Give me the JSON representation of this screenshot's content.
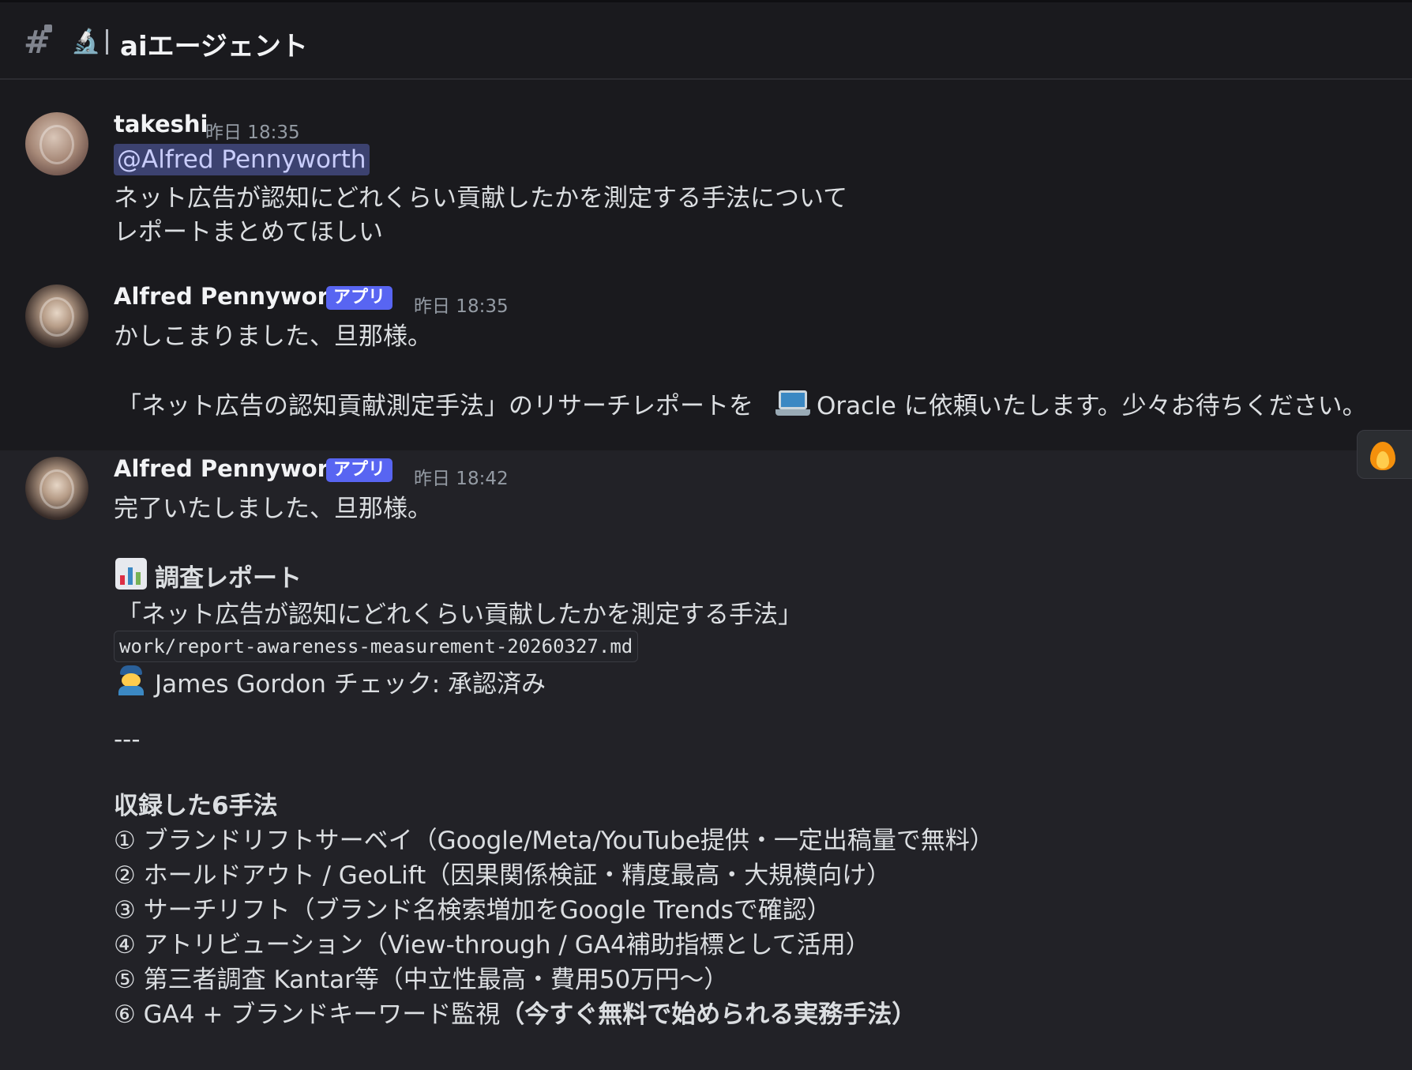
{
  "channel": {
    "hash_symbol": "#",
    "emoji": "🔬",
    "name": "aiエージェント"
  },
  "messages": [
    {
      "author": "takeshi",
      "timestamp": "昨日 18:35",
      "mention": "@Alfred Pennyworth",
      "lines": [
        "ネット広告が認知にどれくらい貢献したかを測定する手法について",
        "レポートまとめてほしい"
      ]
    },
    {
      "author": "Alfred Pennyworth",
      "app_tag": "アプリ",
      "timestamp": "昨日 18:35",
      "line1": "かしこまりました、旦那様。",
      "line2_pre": "「ネット広告の認知貢献測定手法」のリサーチレポートを",
      "line2_post": "Oracle に依頼いたします。少々お待ちください。"
    },
    {
      "author": "Alfred Pennyworth",
      "app_tag": "アプリ",
      "timestamp": "昨日 18:42",
      "line1": "完了いたしました、旦那様。",
      "report_heading": "調査レポート",
      "report_title": "「ネット広告が認知にどれくらい貢献したかを測定する手法」",
      "file_path": "work/report-awareness-measurement-20260327.md",
      "check_text": "James Gordon チェック: 承認済み",
      "divider": "---",
      "methods_heading": "収録した6手法",
      "methods": [
        "① ブランドリフトサーベイ（Google/Meta/YouTube提供・一定出稿量で無料）",
        "② ホールドアウト / GeoLift（因果関係検証・精度最高・大規模向け）",
        "③ サーチリフト（ブランド名検索増加をGoogle Trendsで確認）",
        "④ アトリビューション（View-through / GA4補助指標として活用）",
        "⑤ 第三者調査 Kantar等（中立性最高・費用50万円〜）"
      ],
      "method6_pre": "⑥ GA4 + ブランドキーワード監視",
      "method6_bold": "（今すぐ無料で始められる実務手法）"
    }
  ],
  "reactions": [
    {
      "icon": "fire-icon"
    }
  ],
  "colors": {
    "background": "#1a1a1e",
    "hover_background": "#222227",
    "app_tag": "#5865f2",
    "mention_bg": "#3c4270"
  }
}
